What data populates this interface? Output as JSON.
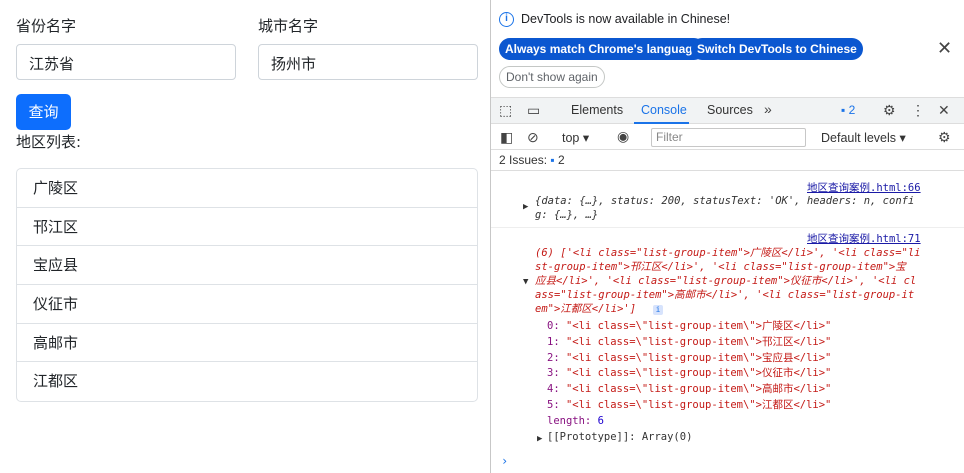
{
  "form": {
    "province_label": "省份名字",
    "province_value": "江苏省",
    "city_label": "城市名字",
    "city_value": "扬州市",
    "query_button": "查询",
    "list_label": "地区列表:"
  },
  "regions": [
    "广陵区",
    "邗江区",
    "宝应县",
    "仪征市",
    "高邮市",
    "江都区"
  ],
  "devtools": {
    "banner_text": "DevTools is now available in Chinese!",
    "btn_match": "Always match Chrome's language",
    "btn_switch": "Switch DevTools to Chinese",
    "btn_dont_show": "Don't show again",
    "tabs": [
      "Elements",
      "Console",
      "Sources"
    ],
    "issues_count": "2",
    "context": "top",
    "filter_placeholder": "Filter",
    "levels": "Default levels",
    "issues_label": "2 Issues:",
    "issues_badge": "2",
    "accent": "#1a73e8"
  },
  "console": {
    "log1_source": "地区查询案例.html:66",
    "log1_text_a": "{data: {…}, status: 200, statusText: 'OK', headers: n, confi",
    "log1_text_b": "g: {…}, …}",
    "log2_source": "地区查询案例.html:71",
    "log2_line1": "(6) ['<li class=\"list-group-item\">广陵区</li>', '<li class=\"li",
    "log2_line2": "st-group-item\">邗江区</li>', '<li class=\"list-group-item\">宝",
    "log2_line3": "应县</li>', '<li class=\"list-group-item\">仪征市</li>', '<li cl",
    "log2_line4": "ass=\"list-group-item\">高邮市</li>', '<li class=\"list-group-it",
    "log2_line5": "em\">江都区</li>']",
    "entries": [
      {
        "k": "0:",
        "v": "\"<li class=\\\"list-group-item\\\">广陵区</li>\""
      },
      {
        "k": "1:",
        "v": "\"<li class=\\\"list-group-item\\\">邗江区</li>\""
      },
      {
        "k": "2:",
        "v": "\"<li class=\\\"list-group-item\\\">宝应县</li>\""
      },
      {
        "k": "3:",
        "v": "\"<li class=\\\"list-group-item\\\">仪征市</li>\""
      },
      {
        "k": "4:",
        "v": "\"<li class=\\\"list-group-item\\\">高邮市</li>\""
      },
      {
        "k": "5:",
        "v": "\"<li class=\\\"list-group-item\\\">江都区</li>\""
      }
    ],
    "length_key": "length:",
    "length_val": "6",
    "prototype": "[[Prototype]]: Array(0)",
    "prompt": "›"
  }
}
